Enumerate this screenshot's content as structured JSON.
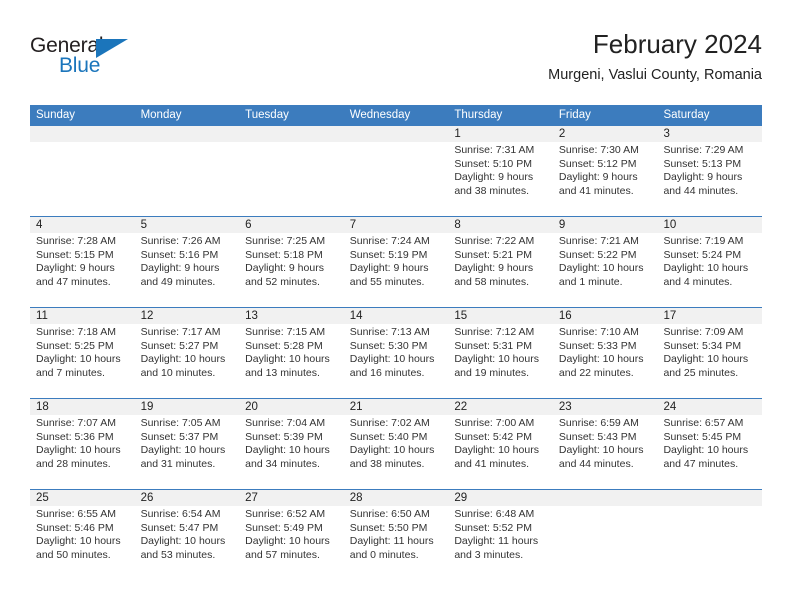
{
  "brand": {
    "name_part1": "General",
    "name_part2": "Blue",
    "logo_icon": "triangle-flag-icon",
    "accent_color": "#1b75bb"
  },
  "header": {
    "title": "February 2024",
    "subtitle": "Murgeni, Vaslui County, Romania"
  },
  "theme": {
    "header_blue": "#3c7cbe",
    "daynum_band_gray": "#f1f1f1",
    "text": "#222222"
  },
  "weekdays": [
    "Sunday",
    "Monday",
    "Tuesday",
    "Wednesday",
    "Thursday",
    "Friday",
    "Saturday"
  ],
  "weeks": [
    [
      {
        "day": "",
        "sunrise": "",
        "sunset": "",
        "daylight_line1": "",
        "daylight_line2": ""
      },
      {
        "day": "",
        "sunrise": "",
        "sunset": "",
        "daylight_line1": "",
        "daylight_line2": ""
      },
      {
        "day": "",
        "sunrise": "",
        "sunset": "",
        "daylight_line1": "",
        "daylight_line2": ""
      },
      {
        "day": "",
        "sunrise": "",
        "sunset": "",
        "daylight_line1": "",
        "daylight_line2": ""
      },
      {
        "day": "1",
        "sunrise": "Sunrise: 7:31 AM",
        "sunset": "Sunset: 5:10 PM",
        "daylight_line1": "Daylight: 9 hours",
        "daylight_line2": "and 38 minutes."
      },
      {
        "day": "2",
        "sunrise": "Sunrise: 7:30 AM",
        "sunset": "Sunset: 5:12 PM",
        "daylight_line1": "Daylight: 9 hours",
        "daylight_line2": "and 41 minutes."
      },
      {
        "day": "3",
        "sunrise": "Sunrise: 7:29 AM",
        "sunset": "Sunset: 5:13 PM",
        "daylight_line1": "Daylight: 9 hours",
        "daylight_line2": "and 44 minutes."
      }
    ],
    [
      {
        "day": "4",
        "sunrise": "Sunrise: 7:28 AM",
        "sunset": "Sunset: 5:15 PM",
        "daylight_line1": "Daylight: 9 hours",
        "daylight_line2": "and 47 minutes."
      },
      {
        "day": "5",
        "sunrise": "Sunrise: 7:26 AM",
        "sunset": "Sunset: 5:16 PM",
        "daylight_line1": "Daylight: 9 hours",
        "daylight_line2": "and 49 minutes."
      },
      {
        "day": "6",
        "sunrise": "Sunrise: 7:25 AM",
        "sunset": "Sunset: 5:18 PM",
        "daylight_line1": "Daylight: 9 hours",
        "daylight_line2": "and 52 minutes."
      },
      {
        "day": "7",
        "sunrise": "Sunrise: 7:24 AM",
        "sunset": "Sunset: 5:19 PM",
        "daylight_line1": "Daylight: 9 hours",
        "daylight_line2": "and 55 minutes."
      },
      {
        "day": "8",
        "sunrise": "Sunrise: 7:22 AM",
        "sunset": "Sunset: 5:21 PM",
        "daylight_line1": "Daylight: 9 hours",
        "daylight_line2": "and 58 minutes."
      },
      {
        "day": "9",
        "sunrise": "Sunrise: 7:21 AM",
        "sunset": "Sunset: 5:22 PM",
        "daylight_line1": "Daylight: 10 hours",
        "daylight_line2": "and 1 minute."
      },
      {
        "day": "10",
        "sunrise": "Sunrise: 7:19 AM",
        "sunset": "Sunset: 5:24 PM",
        "daylight_line1": "Daylight: 10 hours",
        "daylight_line2": "and 4 minutes."
      }
    ],
    [
      {
        "day": "11",
        "sunrise": "Sunrise: 7:18 AM",
        "sunset": "Sunset: 5:25 PM",
        "daylight_line1": "Daylight: 10 hours",
        "daylight_line2": "and 7 minutes."
      },
      {
        "day": "12",
        "sunrise": "Sunrise: 7:17 AM",
        "sunset": "Sunset: 5:27 PM",
        "daylight_line1": "Daylight: 10 hours",
        "daylight_line2": "and 10 minutes."
      },
      {
        "day": "13",
        "sunrise": "Sunrise: 7:15 AM",
        "sunset": "Sunset: 5:28 PM",
        "daylight_line1": "Daylight: 10 hours",
        "daylight_line2": "and 13 minutes."
      },
      {
        "day": "14",
        "sunrise": "Sunrise: 7:13 AM",
        "sunset": "Sunset: 5:30 PM",
        "daylight_line1": "Daylight: 10 hours",
        "daylight_line2": "and 16 minutes."
      },
      {
        "day": "15",
        "sunrise": "Sunrise: 7:12 AM",
        "sunset": "Sunset: 5:31 PM",
        "daylight_line1": "Daylight: 10 hours",
        "daylight_line2": "and 19 minutes."
      },
      {
        "day": "16",
        "sunrise": "Sunrise: 7:10 AM",
        "sunset": "Sunset: 5:33 PM",
        "daylight_line1": "Daylight: 10 hours",
        "daylight_line2": "and 22 minutes."
      },
      {
        "day": "17",
        "sunrise": "Sunrise: 7:09 AM",
        "sunset": "Sunset: 5:34 PM",
        "daylight_line1": "Daylight: 10 hours",
        "daylight_line2": "and 25 minutes."
      }
    ],
    [
      {
        "day": "18",
        "sunrise": "Sunrise: 7:07 AM",
        "sunset": "Sunset: 5:36 PM",
        "daylight_line1": "Daylight: 10 hours",
        "daylight_line2": "and 28 minutes."
      },
      {
        "day": "19",
        "sunrise": "Sunrise: 7:05 AM",
        "sunset": "Sunset: 5:37 PM",
        "daylight_line1": "Daylight: 10 hours",
        "daylight_line2": "and 31 minutes."
      },
      {
        "day": "20",
        "sunrise": "Sunrise: 7:04 AM",
        "sunset": "Sunset: 5:39 PM",
        "daylight_line1": "Daylight: 10 hours",
        "daylight_line2": "and 34 minutes."
      },
      {
        "day": "21",
        "sunrise": "Sunrise: 7:02 AM",
        "sunset": "Sunset: 5:40 PM",
        "daylight_line1": "Daylight: 10 hours",
        "daylight_line2": "and 38 minutes."
      },
      {
        "day": "22",
        "sunrise": "Sunrise: 7:00 AM",
        "sunset": "Sunset: 5:42 PM",
        "daylight_line1": "Daylight: 10 hours",
        "daylight_line2": "and 41 minutes."
      },
      {
        "day": "23",
        "sunrise": "Sunrise: 6:59 AM",
        "sunset": "Sunset: 5:43 PM",
        "daylight_line1": "Daylight: 10 hours",
        "daylight_line2": "and 44 minutes."
      },
      {
        "day": "24",
        "sunrise": "Sunrise: 6:57 AM",
        "sunset": "Sunset: 5:45 PM",
        "daylight_line1": "Daylight: 10 hours",
        "daylight_line2": "and 47 minutes."
      }
    ],
    [
      {
        "day": "25",
        "sunrise": "Sunrise: 6:55 AM",
        "sunset": "Sunset: 5:46 PM",
        "daylight_line1": "Daylight: 10 hours",
        "daylight_line2": "and 50 minutes."
      },
      {
        "day": "26",
        "sunrise": "Sunrise: 6:54 AM",
        "sunset": "Sunset: 5:47 PM",
        "daylight_line1": "Daylight: 10 hours",
        "daylight_line2": "and 53 minutes."
      },
      {
        "day": "27",
        "sunrise": "Sunrise: 6:52 AM",
        "sunset": "Sunset: 5:49 PM",
        "daylight_line1": "Daylight: 10 hours",
        "daylight_line2": "and 57 minutes."
      },
      {
        "day": "28",
        "sunrise": "Sunrise: 6:50 AM",
        "sunset": "Sunset: 5:50 PM",
        "daylight_line1": "Daylight: 11 hours",
        "daylight_line2": "and 0 minutes."
      },
      {
        "day": "29",
        "sunrise": "Sunrise: 6:48 AM",
        "sunset": "Sunset: 5:52 PM",
        "daylight_line1": "Daylight: 11 hours",
        "daylight_line2": "and 3 minutes."
      },
      {
        "day": "",
        "sunrise": "",
        "sunset": "",
        "daylight_line1": "",
        "daylight_line2": ""
      },
      {
        "day": "",
        "sunrise": "",
        "sunset": "",
        "daylight_line1": "",
        "daylight_line2": ""
      }
    ]
  ]
}
